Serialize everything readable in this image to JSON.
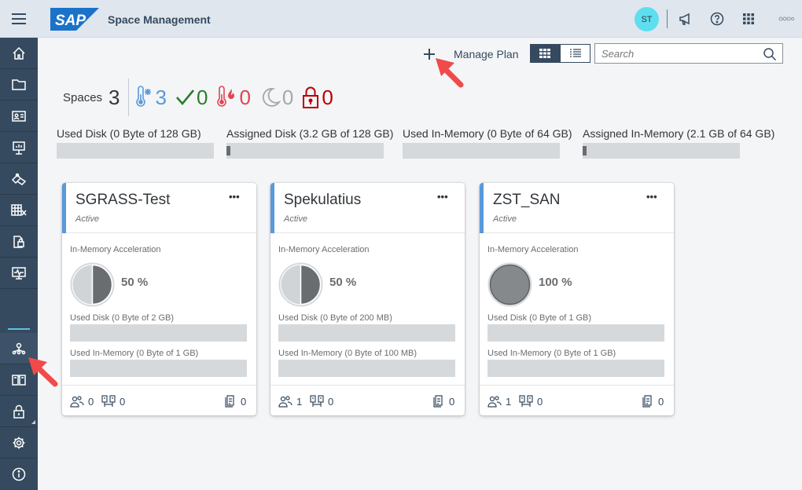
{
  "shell": {
    "logo_text": "SAP",
    "title": "Space Management",
    "avatar_initials": "ST",
    "icons": [
      "menu-icon",
      "megaphone-icon",
      "help-icon",
      "grid-icon",
      "more-icon"
    ]
  },
  "sidenav": {
    "items": [
      "home-icon",
      "folder-icon",
      "business-card-icon",
      "presentation-icon",
      "data-builder-icon",
      "table-view-icon",
      "data-access-icon",
      "monitor-icon",
      "space-management-icon",
      "catalog-icon",
      "security-icon",
      "settings-icon",
      "info-icon"
    ],
    "selected": "space-management-icon"
  },
  "toolbar": {
    "manage_plan": "Manage Plan",
    "search_placeholder": "Search"
  },
  "kpis": {
    "spaces_label": "Spaces",
    "spaces_count": "3",
    "cold": "3",
    "ok": "0",
    "hot": "0",
    "inactive": "0",
    "locked": "0",
    "colors": {
      "cold": "#5899da",
      "ok": "#2b7d2b",
      "hot": "#e34352",
      "inactive": "#a5a8ab",
      "locked": "#bb0000"
    }
  },
  "capacity": [
    {
      "label": "Used Disk (0 Byte of 128 GB)",
      "fill": 0
    },
    {
      "label": "Assigned Disk (3.2 GB of 128 GB)",
      "fill": 0.025
    },
    {
      "label": "Used In-Memory (0 Byte of 64 GB)",
      "fill": 0
    },
    {
      "label": "Assigned In-Memory (2.1 GB of 64 GB)",
      "fill": 0.033
    }
  ],
  "cards": [
    {
      "title": "SGRASS-Test",
      "status": "Active",
      "accel_label": "In-Memory Acceleration",
      "accel_pct": "50 %",
      "accel_value": 0.5,
      "disk_label": "Used Disk (0 Byte of 2 GB)",
      "mem_label": "Used In-Memory (0 Byte of 1 GB)",
      "users": "0",
      "connections": "0",
      "objects": "0"
    },
    {
      "title": "Spekulatius",
      "status": "Active",
      "accel_label": "In-Memory Acceleration",
      "accel_pct": "50 %",
      "accel_value": 0.5,
      "disk_label": "Used Disk (0 Byte of 200 MB)",
      "mem_label": "Used In-Memory (0 Byte of 100 MB)",
      "users": "1",
      "connections": "0",
      "objects": "0"
    },
    {
      "title": "ZST_SAN",
      "status": "Active",
      "accel_label": "In-Memory Acceleration",
      "accel_pct": "100 %",
      "accel_value": 1.0,
      "disk_label": "Used Disk (0 Byte of 1 GB)",
      "mem_label": "Used In-Memory (0 Byte of 1 GB)",
      "users": "1",
      "connections": "0",
      "objects": "0"
    }
  ]
}
